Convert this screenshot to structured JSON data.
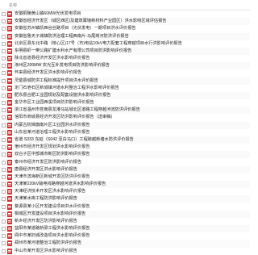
{
  "header": {
    "name_label": "名称"
  },
  "files": [
    "安徽铜陵黄山镇60MW光伏发电项目",
    "安徽省经济开发区（城区西区)及建筑幕墙新材料产业园区）洪水影响区域评估报告",
    "安徽省苏州镇凯西谷丝路项目（光伏发电）一期项目洪水评价报告",
    "安徽省鲁天子城镇防洪治理工程西南片-马尾岗河防洪评价报告",
    "北京区县东北中路（核心区)17号（市)电站10kV电力配套工程穿越项目水行洪影响评价报告",
    "东明县虾一带公路扩建水利水产有限公司项目防洪影响评价报告",
    "陕北省道县经济开发区洪水影响评价报告",
    "涿州区200MW 农光互补发电项目防洪影响评价报告",
    "怀来县经济开发区洪水影响评价报告",
    "灵璧县城防洪工程标准提升项目洪水评价报告",
    "定门石皂石区新城镇河道水利整治工程洪水影响评价报告",
    "肥东县合肥工业园规划及配套设施洪水影响评价报告",
    "金华市区工业园西溪项目防洪影响评价报告",
    "浙江省温州市苍南县龙港马站城北区道路工程穿越河流防洪评价报告",
    "信阳市商城县经济开发区防洪影响评价报告（送审稿)",
    "内蒙古杭锦旗南片区工业园洪水评价报告",
    "山东省某河道治理工程洪水影响评价报告",
    "省道 S333 东延（S042 至白马口）工程跨越新塘水防洪评价报告",
    "宿州市经济开发区规划洪水影响评价报告",
    "双台子区中部城市新区防洪影响评价报告",
    "泰州市经济开发区防洪影响评价报告",
    "唐县经济开发区洪水影响评价报告",
    "天津市滨海新区新城开发区防洪评价报告",
    "天津某220kV输电线路穿越河道洪水影响评价报告",
    "天津经济技术开发区洪水影响评价报告",
    "天津某水库工程防洪影响评价报告",
    "婺源县某小区开发建设项目洪水评价报告",
    "相城区开发建设项目洪水影响评价报告",
    "新乡经济开发区防洪影响评价报告",
    "益阳市某道路桥梁工程洪水影响评价报告",
    "阆中市某旧城改造项目洪水影响评价报告",
    "郑州市某河道整治工程防洪评价报告",
    "中山市某开发区洪水影响评价报告"
  ]
}
